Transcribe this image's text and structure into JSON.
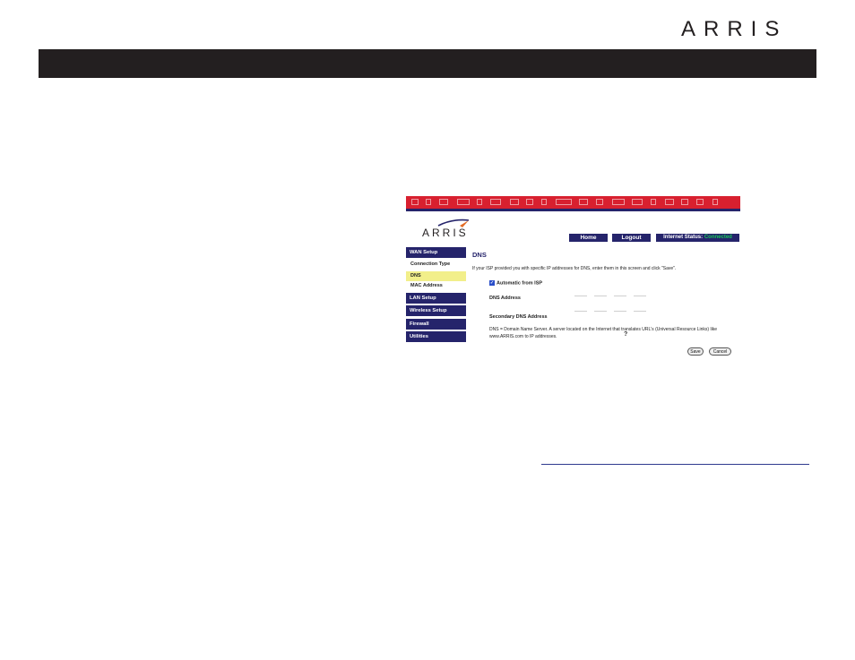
{
  "document": {
    "brand": "ARRIS"
  },
  "screenshot": {
    "brand": "ARRIS",
    "header_buttons": {
      "home": "Home",
      "logout": "Logout"
    },
    "internet_status": {
      "label": "Internet Status:",
      "value": "Connected"
    },
    "sidebar": [
      {
        "label": "WAN Setup",
        "kind": "heading"
      },
      {
        "label": "Connection Type",
        "kind": "item"
      },
      {
        "label": "DNS",
        "kind": "item",
        "active": true
      },
      {
        "label": "MAC Address",
        "kind": "item"
      },
      {
        "label": "LAN Setup",
        "kind": "heading"
      },
      {
        "label": "Wireless Setup",
        "kind": "heading"
      },
      {
        "label": "Firewall",
        "kind": "heading"
      },
      {
        "label": "Utilities",
        "kind": "heading"
      }
    ],
    "main": {
      "title": "DNS",
      "intro": "If your ISP provided you with specific IP addresses for DNS, enter them in this screen and click \"Save\".",
      "auto_label": "Automatic from ISP",
      "auto_checked": true,
      "dns_label": "DNS Address",
      "secondary_label": "Secondary DNS Address",
      "note": "DNS = Domain Name Server. A server located on the Internet that translates URL's (Universal Resource Links) like www.ARRIS.com to IP addresses.",
      "help": "?",
      "save": "Save",
      "cancel": "Cancel"
    },
    "colors": {
      "banner_red": "#d8202f",
      "navy": "#25246b",
      "status_green": "#19c65a",
      "active_highlight": "#f2ef8a"
    }
  }
}
